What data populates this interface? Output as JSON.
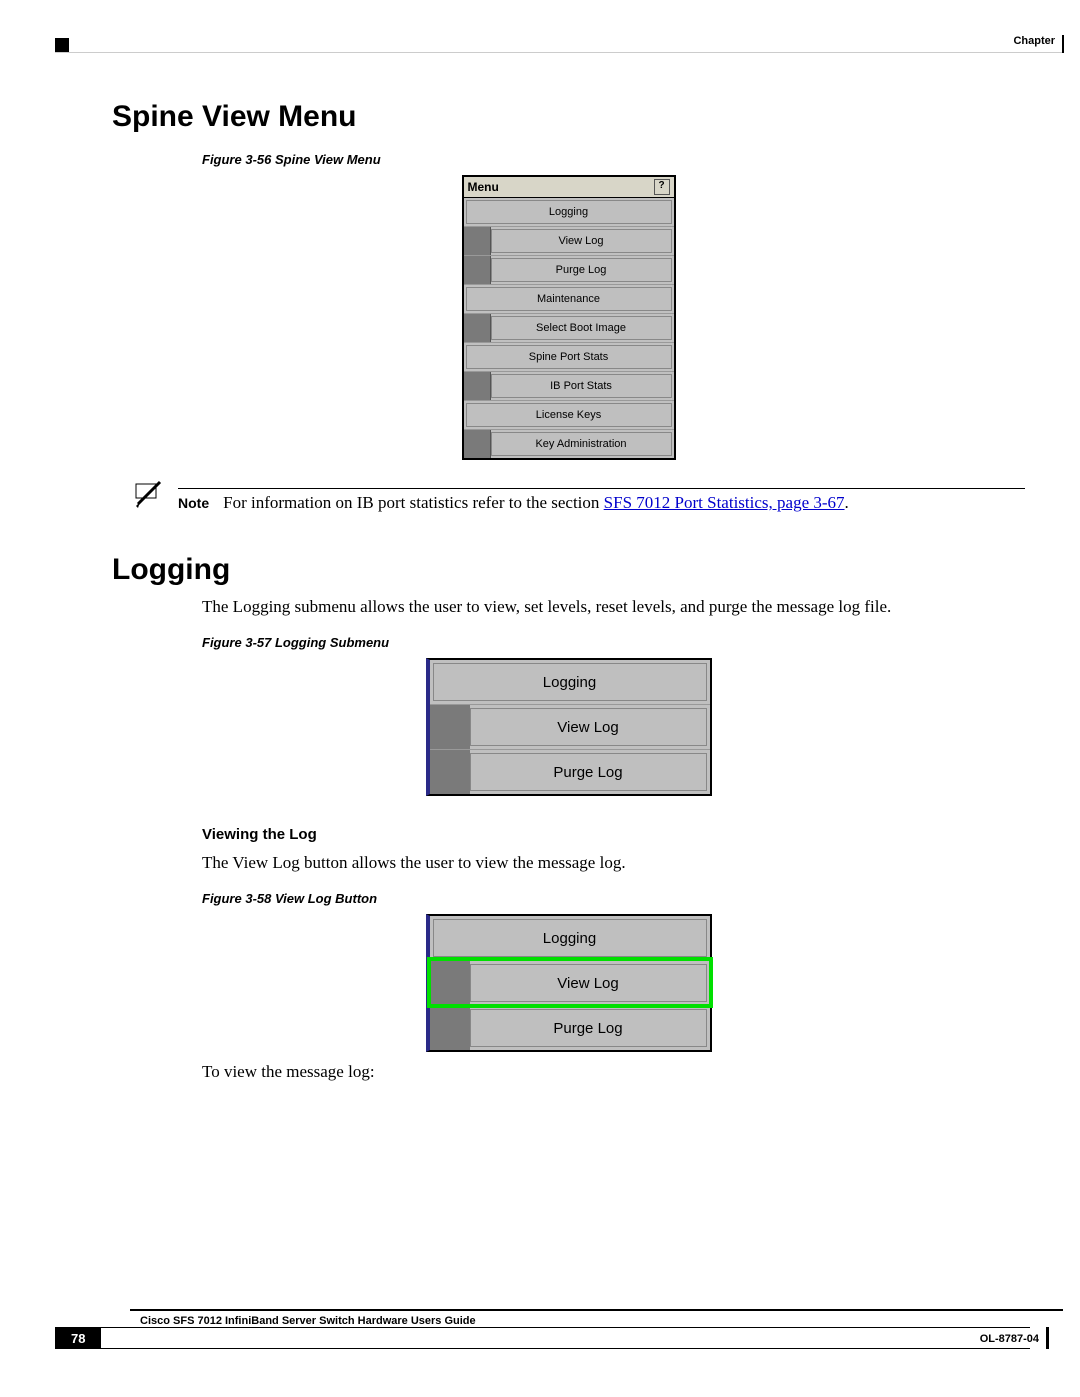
{
  "header": {
    "chapter_label": "Chapter"
  },
  "sections": {
    "spine_title": "Spine View Menu",
    "logging_title": "Logging",
    "viewing_heading": "Viewing the Log"
  },
  "captions": {
    "fig56": "Figure 3-56   Spine View Menu",
    "fig57": "Figure 3-57   Logging Submenu",
    "fig58": "Figure 3-58   View Log Button"
  },
  "note": {
    "label": "Note",
    "text_pre": "For information on IB port statistics refer to the section ",
    "link": "SFS 7012 Port Statistics, page 3-67",
    "text_post": "."
  },
  "body": {
    "logging_intro": "The Logging submenu allows the user to view, set levels, reset levels, and purge the message log file.",
    "viewlog_intro": "The View Log button allows the user to view the message log.",
    "to_view": "To view the message log:"
  },
  "menu1": {
    "title": "Menu",
    "help": "?",
    "items": [
      {
        "label": "Logging",
        "stub": false
      },
      {
        "label": "View Log",
        "stub": true
      },
      {
        "label": "Purge Log",
        "stub": true
      },
      {
        "label": "Maintenance",
        "stub": false
      },
      {
        "label": "Select Boot Image",
        "stub": true
      },
      {
        "label": "Spine Port Stats",
        "stub": false
      },
      {
        "label": "IB Port Stats",
        "stub": true
      },
      {
        "label": "License Keys",
        "stub": false
      },
      {
        "label": "Key Administration",
        "stub": true
      }
    ]
  },
  "menu2": {
    "items": [
      {
        "label": "Logging",
        "stub": false
      },
      {
        "label": "View Log",
        "stub": true
      },
      {
        "label": "Purge Log",
        "stub": true
      }
    ]
  },
  "menu3": {
    "items": [
      {
        "label": "Logging",
        "stub": false,
        "highlight": false
      },
      {
        "label": "View Log",
        "stub": true,
        "highlight": true
      },
      {
        "label": "Purge Log",
        "stub": true,
        "highlight": false
      }
    ]
  },
  "footer": {
    "guide": "Cisco SFS 7012 InfiniBand Server Switch Hardware Users Guide",
    "page": "78",
    "docid": "OL-8787-04"
  }
}
